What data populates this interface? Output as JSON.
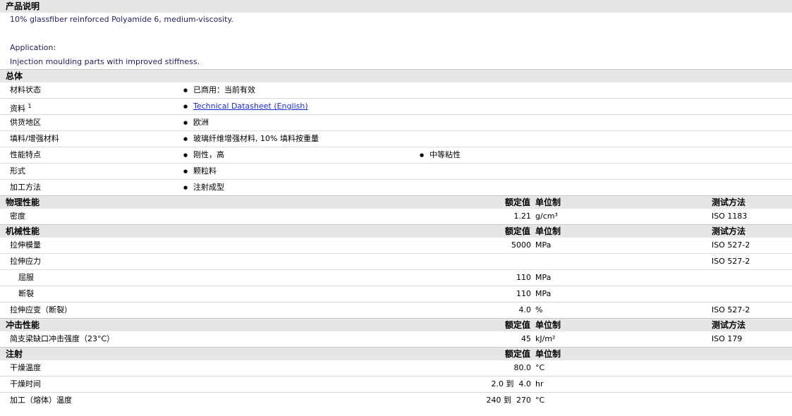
{
  "product_desc": {
    "title": "产品说明",
    "line1": "10% glassfiber reinforced Polyamide 6, medium-viscosity.",
    "app_label": "Application:",
    "app_text": "Injection moulding parts with improved stiffness."
  },
  "general": {
    "title": "总体",
    "rows": [
      {
        "label": "材料状态",
        "value": "已商用：当前有效"
      },
      {
        "label": "资料",
        "sup": "1",
        "value": "Technical Datasheet (English)"
      },
      {
        "label": "供货地区",
        "value": "欧洲"
      },
      {
        "label": "填料/增强材料",
        "value": "玻璃纤维增强材料, 10% 填料按重量"
      },
      {
        "label": "性能特点",
        "value": "刚性，高",
        "value2": "中等粘性"
      },
      {
        "label": "形式",
        "value": "颗粒料"
      },
      {
        "label": "加工方法",
        "value": "注射成型"
      }
    ]
  },
  "headers": {
    "nominal": "额定值",
    "unit": "单位制",
    "method": "测试方法"
  },
  "physical": {
    "title": "物理性能",
    "rows": [
      {
        "label": "密度",
        "value": "1.21",
        "unit": "g/cm³",
        "method": "ISO 1183"
      }
    ]
  },
  "mechanical": {
    "title": "机械性能",
    "rows": [
      {
        "label": "拉伸模量",
        "value": "5000",
        "unit": "MPa",
        "method": "ISO 527-2"
      },
      {
        "label": "拉伸应力",
        "value": "",
        "unit": "",
        "method": "ISO 527-2"
      },
      {
        "label": "屈服",
        "value": "110",
        "unit": "MPa",
        "method": ""
      },
      {
        "label": "断裂",
        "value": "110",
        "unit": "MPa",
        "method": ""
      },
      {
        "label": "拉伸应变（断裂）",
        "value": "4.0",
        "unit": "%",
        "method": "ISO 527-2"
      }
    ]
  },
  "impact": {
    "title": "冲击性能",
    "rows": [
      {
        "label": "简支梁缺口冲击强度（23°C）",
        "value": "45",
        "unit": "kJ/m²",
        "method": "ISO 179"
      }
    ]
  },
  "injection": {
    "title": "注射",
    "rows": [
      {
        "label": "干燥温度",
        "value": "80.0",
        "unit": "°C"
      },
      {
        "label": "干燥时间",
        "value": "2.0 到  4.0",
        "unit": "hr"
      },
      {
        "label": "加工（熔体）温度",
        "value": "240 到  270",
        "unit": "°C"
      }
    ]
  }
}
